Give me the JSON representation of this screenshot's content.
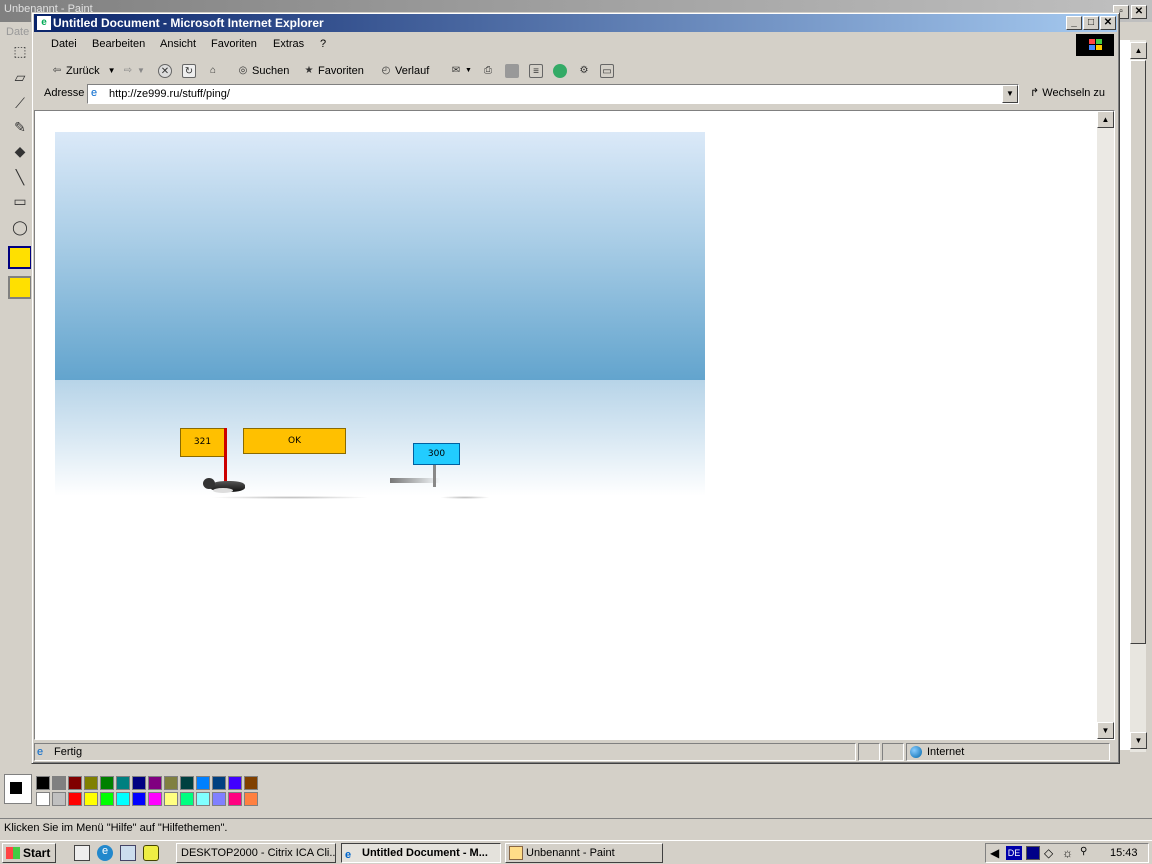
{
  "paint": {
    "title_fragment": "Unbenannt - Paint",
    "menu_fragment": "Date",
    "status_text": "Klicken Sie im Menü \"Hilfe\" auf \"Hilfethemen\".",
    "palette_top": [
      "#000000",
      "#808080",
      "#800000",
      "#808000",
      "#008000",
      "#008080",
      "#000080",
      "#800080",
      "#808040",
      "#004040",
      "#0080ff",
      "#004080",
      "#4000ff",
      "#804000"
    ],
    "palette_bottom": [
      "#ffffff",
      "#c0c0c0",
      "#ff0000",
      "#ffff00",
      "#00ff00",
      "#00ffff",
      "#0000ff",
      "#ff00ff",
      "#ffff80",
      "#00ff80",
      "#80ffff",
      "#8080ff",
      "#ff0080",
      "#ff8040"
    ]
  },
  "ie": {
    "title": "Untitled Document - Microsoft Internet Explorer",
    "menu": [
      "Datei",
      "Bearbeiten",
      "Ansicht",
      "Favoriten",
      "Extras",
      "?"
    ],
    "toolbar": {
      "back": "Zurück",
      "search": "Suchen",
      "favorites": "Favoriten",
      "history": "Verlauf"
    },
    "address_label": "Adresse",
    "address_value": "http://ze999.ru/stuff/ping/",
    "go_label": "Wechseln zu",
    "status_text": "Fertig",
    "zone_text": "Internet"
  },
  "game": {
    "score_sign": "321",
    "ok_sign": "OK",
    "target_sign": "300",
    "colors": {
      "sign_yellow": "#ffc000",
      "sign_cyan": "#22ccff",
      "pole_red": "#cc0000"
    }
  },
  "taskbar": {
    "start": "Start",
    "tasks": [
      "DESKTOP2000 - Citrix ICA Cli...",
      "Untitled Document - M...",
      "Unbenannt - Paint"
    ],
    "lang": "DE",
    "clock": "15:43"
  }
}
